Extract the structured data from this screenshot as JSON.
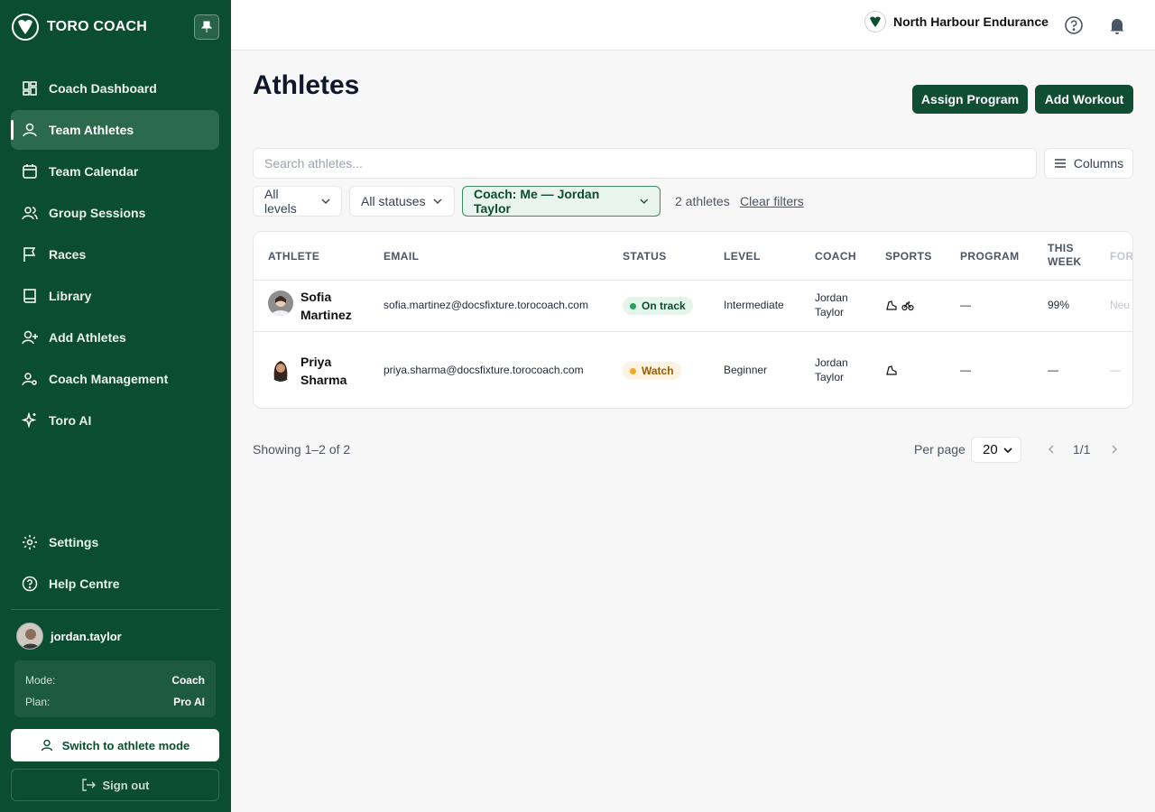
{
  "brand": {
    "name": "TORO COACH"
  },
  "sidebar": {
    "items": [
      {
        "label": "Coach Dashboard",
        "icon": "dashboard-icon"
      },
      {
        "label": "Team Athletes",
        "icon": "users-icon",
        "active": true
      },
      {
        "label": "Team Calendar",
        "icon": "calendar-icon"
      },
      {
        "label": "Group Sessions",
        "icon": "group-icon"
      },
      {
        "label": "Races",
        "icon": "flag-icon"
      },
      {
        "label": "Library",
        "icon": "book-icon"
      },
      {
        "label": "Add Athletes",
        "icon": "user-plus-icon"
      },
      {
        "label": "Coach Management",
        "icon": "user-cog-icon"
      },
      {
        "label": "Toro AI",
        "icon": "sparkle-icon"
      }
    ],
    "bottom": [
      {
        "label": "Settings",
        "icon": "gear-icon"
      },
      {
        "label": "Help Centre",
        "icon": "help-circle-icon"
      }
    ],
    "user": {
      "name": "jordan.taylor"
    },
    "plan": {
      "mode_label": "Mode:",
      "mode_value": "Coach",
      "plan_label": "Plan:",
      "plan_value": "Pro AI"
    },
    "switch_label": "Switch to athlete mode",
    "signout_label": "Sign out"
  },
  "topbar": {
    "org_name": "North Harbour Endurance"
  },
  "main": {
    "title": "Athletes",
    "assign_label": "Assign Program",
    "add_label": "Add Workout",
    "search_placeholder": "Search athletes...",
    "columns_label": "Columns",
    "filters": {
      "levels": "All levels",
      "statuses": "All statuses",
      "coach": "Coach: Me — Jordan Taylor"
    },
    "count": "2 athletes",
    "clear_label": "Clear filters"
  },
  "table": {
    "headers": {
      "athlete": "ATHLETE",
      "email": "EMAIL",
      "status": "STATUS",
      "level": "LEVEL",
      "coach": "COACH",
      "sports": "SPORTS",
      "program": "PROGRAM",
      "week_1": "THIS",
      "week_2": "WEEK",
      "form": "FOR"
    },
    "rows": [
      {
        "first": "Sofia",
        "last": "Martinez",
        "email": "sofia.martinez@docsfixture.torocoach.com",
        "status": "On track",
        "level": "Intermediate",
        "coach_first": "Jordan",
        "coach_last": "Taylor",
        "program": "—",
        "week": "99%",
        "form": "Neu"
      },
      {
        "first": "Priya",
        "last": "Sharma",
        "email": "priya.sharma@docsfixture.torocoach.com",
        "status": "Watch",
        "level": "Beginner",
        "coach_first": "Jordan",
        "coach_last": "Taylor",
        "program": "—",
        "week": "—",
        "form": "—"
      }
    ]
  },
  "footer": {
    "showing": "Showing 1–2 of 2",
    "per_page_label": "Per page",
    "per_page_value": "20",
    "page": "1/1"
  },
  "colors": {
    "sidebar": "#0b4d30",
    "primary": "#104e33",
    "ok": "#22a25a",
    "watch": "#f5a623"
  }
}
